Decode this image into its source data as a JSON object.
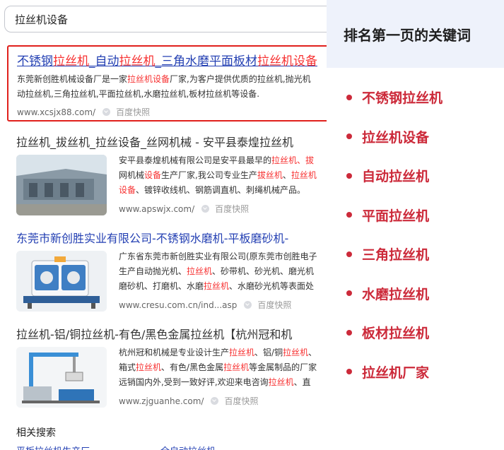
{
  "search": {
    "query": "拉丝机设备"
  },
  "results": [
    {
      "title_parts": [
        {
          "t": "不锈钢",
          "hl": false
        },
        {
          "t": "拉丝机",
          "hl": true
        },
        {
          "t": "_自动",
          "hl": false
        },
        {
          "t": "拉丝机",
          "hl": true
        },
        {
          "t": "_三角水磨平面板材",
          "hl": false
        },
        {
          "t": "拉丝机设备",
          "hl": true
        }
      ],
      "snippet_lines": [
        [
          {
            "t": "东莞新创胜机械设备厂是一家",
            "hl": false
          },
          {
            "t": "拉丝机设备",
            "hl": true
          },
          {
            "t": "厂家,为客户提供优质的拉丝机,抛光机",
            "hl": false
          }
        ],
        [
          {
            "t": "动拉丝机,三角拉丝机,平面拉丝机,水磨拉丝机,板材拉丝机等设备.",
            "hl": false
          }
        ]
      ],
      "site": "www.xcsjx88.com/",
      "kuaizhao": "百度快照"
    },
    {
      "title_parts": [
        {
          "t": "拉丝机",
          "hl": true
        },
        {
          "t": "_拔丝机",
          "hl": true
        },
        {
          "t": "_拉丝设备",
          "hl": true
        },
        {
          "t": "_丝网机械 - 安平县泰煌",
          "hl": false
        },
        {
          "t": "拉丝机",
          "hl": true
        }
      ],
      "snippet_lines": [
        [
          {
            "t": "安平县泰煌机械有限公司是安平县最早的",
            "hl": false
          },
          {
            "t": "拉丝机",
            "hl": true
          },
          {
            "t": "、拔",
            "hl": true
          }
        ],
        [
          {
            "t": "网机械",
            "hl": false
          },
          {
            "t": "设备",
            "hl": true
          },
          {
            "t": "生产厂家,我公司专业生产",
            "hl": false
          },
          {
            "t": "拔丝机",
            "hl": true
          },
          {
            "t": "、",
            "hl": false
          },
          {
            "t": "拉丝机",
            "hl": true
          }
        ],
        [
          {
            "t": "设备",
            "hl": true
          },
          {
            "t": "、镀锌收线机、钢筋调直机、刺绳机械产品。",
            "hl": false
          }
        ]
      ],
      "site": "www.apswjx.com/",
      "kuaizhao": "百度快照"
    },
    {
      "title_parts": [
        {
          "t": "东莞市新创胜实业有限公司-不锈钢水磨机-平板磨砂机-",
          "hl": false
        }
      ],
      "snippet_lines": [
        [
          {
            "t": "广东省东莞市新创胜实业有限公司(原东莞市创胜电子",
            "hl": false
          }
        ],
        [
          {
            "t": "生产自动抛光机、",
            "hl": false
          },
          {
            "t": "拉丝机",
            "hl": true
          },
          {
            "t": "、砂带机、砂光机、磨光机",
            "hl": false
          }
        ],
        [
          {
            "t": "磨砂机、打磨机、水磨",
            "hl": false
          },
          {
            "t": "拉丝机",
            "hl": true
          },
          {
            "t": "、水磨砂光机等表面处",
            "hl": false
          }
        ]
      ],
      "site": "www.cresu.com.cn/ind...asp",
      "kuaizhao": "百度快照"
    },
    {
      "title_parts": [
        {
          "t": "拉丝机",
          "hl": true
        },
        {
          "t": "-铝/铜",
          "hl": false
        },
        {
          "t": "拉丝机",
          "hl": true
        },
        {
          "t": "-有色/黑色金属",
          "hl": false
        },
        {
          "t": "拉丝机",
          "hl": true
        },
        {
          "t": "【杭州冠和机",
          "hl": false
        }
      ],
      "snippet_lines": [
        [
          {
            "t": "杭州冠和机械是专业设计生产",
            "hl": false
          },
          {
            "t": "拉丝机",
            "hl": true
          },
          {
            "t": "、铝/铜",
            "hl": false
          },
          {
            "t": "拉丝机",
            "hl": true
          },
          {
            "t": "、",
            "hl": false
          }
        ],
        [
          {
            "t": "箱式",
            "hl": false
          },
          {
            "t": "拉丝机",
            "hl": true
          },
          {
            "t": "、有色/黑色金属",
            "hl": false
          },
          {
            "t": "拉丝机",
            "hl": true
          },
          {
            "t": "等金属制品的厂家",
            "hl": false
          }
        ],
        [
          {
            "t": "远销国内外,受到一致好评,欢迎来电咨询",
            "hl": false
          },
          {
            "t": "拉丝机",
            "hl": true
          },
          {
            "t": "、直",
            "hl": false
          }
        ]
      ],
      "site": "www.zjguanhe.com/",
      "kuaizhao": "百度快照"
    }
  ],
  "related": {
    "label": "相关搜索",
    "links": [
      "平板拉丝机生产厂",
      "全自动拉丝机"
    ]
  },
  "panel": {
    "title": "排名第一页的关键词",
    "accent": "#cc2a3a",
    "keywords": [
      "不锈钢拉丝机",
      "拉丝机设备",
      "自动拉丝机",
      "平面拉丝机",
      "三角拉丝机",
      "水磨拉丝机",
      "板材拉丝机",
      "拉丝机厂家"
    ]
  }
}
